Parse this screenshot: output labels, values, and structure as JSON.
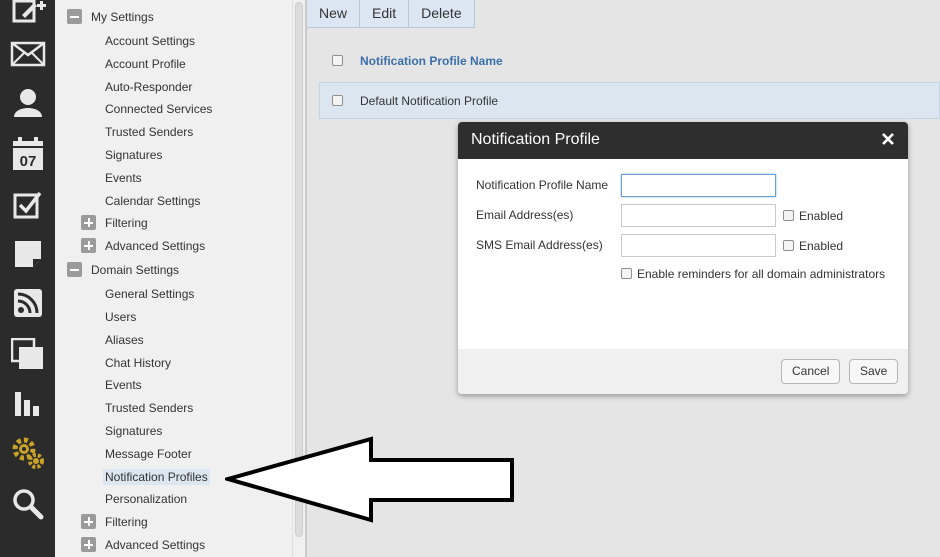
{
  "rail": {
    "icons": [
      "compose-icon",
      "mail-icon",
      "contacts-icon",
      "calendar-icon",
      "tasks-icon",
      "notes-icon",
      "rss-icon",
      "files-icon",
      "reports-icon",
      "settings-icon",
      "search-icon"
    ],
    "calendar_day": "07",
    "active_color": "#c9a227"
  },
  "tree": {
    "my_settings": {
      "label": "My Settings",
      "items": [
        "Account Settings",
        "Account Profile",
        "Auto-Responder",
        "Connected Services",
        "Trusted Senders",
        "Signatures",
        "Events",
        "Calendar Settings"
      ],
      "filtering": "Filtering",
      "advanced": "Advanced Settings"
    },
    "domain_settings": {
      "label": "Domain Settings",
      "items": [
        "General Settings",
        "Users",
        "Aliases",
        "Chat History",
        "Events",
        "Trusted Senders",
        "Signatures",
        "Message Footer",
        "Notification Profiles",
        "Personalization"
      ],
      "filtering": "Filtering",
      "advanced": "Advanced Settings"
    }
  },
  "toolbar": {
    "new": "New",
    "edit": "Edit",
    "delete": "Delete"
  },
  "grid": {
    "column": "Notification Profile Name",
    "rows": [
      "Default Notification Profile"
    ]
  },
  "dialog": {
    "title": "Notification Profile",
    "fields": {
      "name_label": "Notification Profile Name",
      "name_value": "",
      "email_label": "Email Address(es)",
      "email_value": "",
      "sms_label": "SMS Email Address(es)",
      "sms_value": "",
      "enabled_label": "Enabled",
      "reminders_label": "Enable reminders for all domain administrators"
    },
    "cancel": "Cancel",
    "save": "Save"
  },
  "colors": {
    "rail_bg": "#2b2b2b",
    "header_link": "#3a6fa8",
    "selected_row": "#dce6f1",
    "dialog_header": "#2e2e2e"
  }
}
